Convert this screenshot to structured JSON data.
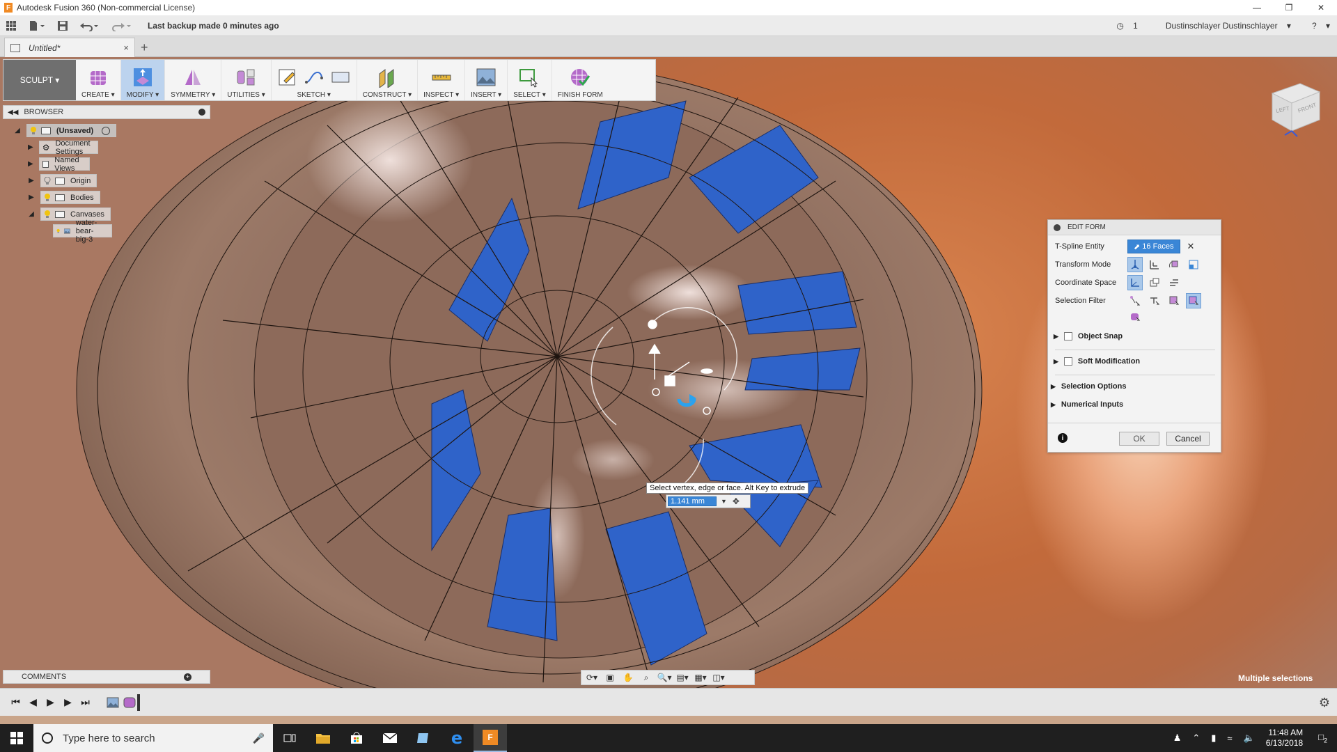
{
  "window": {
    "title": "Autodesk Fusion 360 (Non-commercial License)",
    "app_letter": "F"
  },
  "qab": {
    "backup_status": "Last backup made 0 minutes ago",
    "job_count": "1",
    "user": "Dustinschlayer Dustinschlayer",
    "help": "?"
  },
  "tab": {
    "label": "Untitled*",
    "close": "×",
    "add": "+"
  },
  "toolbar": {
    "workspace": "SCULPT ▾",
    "groups": [
      {
        "label": "CREATE ▾"
      },
      {
        "label": "MODIFY ▾"
      },
      {
        "label": "SYMMETRY ▾"
      },
      {
        "label": "UTILITIES ▾"
      },
      {
        "label": "SKETCH ▾"
      },
      {
        "label": "CONSTRUCT ▾"
      },
      {
        "label": "INSPECT ▾"
      },
      {
        "label": "INSERT ▾"
      },
      {
        "label": "SELECT ▾"
      },
      {
        "label": "FINISH FORM"
      }
    ]
  },
  "browser": {
    "title": "BROWSER",
    "nodes": [
      {
        "label": "(Unsaved)"
      },
      {
        "label": "Document Settings"
      },
      {
        "label": "Named Views"
      },
      {
        "label": "Origin"
      },
      {
        "label": "Bodies"
      },
      {
        "label": "Canvases"
      },
      {
        "label": "water-bear-big-3"
      }
    ]
  },
  "edit_form": {
    "title": "EDIT FORM",
    "tspline_label": "T-Spline Entity",
    "tspline_value": "16 Faces",
    "transform_label": "Transform Mode",
    "coord_label": "Coordinate Space",
    "filter_label": "Selection Filter",
    "object_snap": "Object Snap",
    "soft_mod": "Soft Modification",
    "selection_options": "Selection Options",
    "numerical_inputs": "Numerical Inputs",
    "ok": "OK",
    "cancel": "Cancel"
  },
  "tooltip": "Select vertex, edge or face. Alt Key to extrude",
  "distance_input": {
    "value": "1.141 mm"
  },
  "comments": {
    "title": "COMMENTS"
  },
  "status": {
    "selection": "Multiple selections"
  },
  "viewcube": {
    "left": "LEFT",
    "front": "FRONT"
  },
  "taskbar": {
    "search_placeholder": "Type here to search",
    "time": "11:48 AM",
    "date": "6/13/2018",
    "notifications": "2"
  },
  "colors": {
    "accent": "#3a86d6",
    "selected_face": "#2f63c9",
    "model": "#8a6a5c",
    "background": "#c26a3b"
  }
}
